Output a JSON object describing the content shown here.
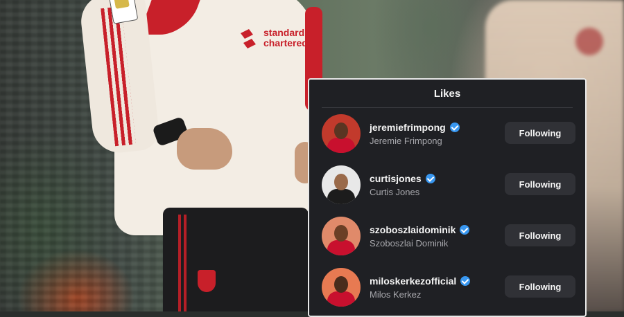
{
  "background": {
    "sponsor_text": "standard chartered"
  },
  "likes_panel": {
    "title": "Likes",
    "items": [
      {
        "username": "jeremiefrimpong",
        "full_name": "Jeremie Frimpong",
        "button_label": "Following",
        "verified": true,
        "avatar_bg": "#c23a2c",
        "avatar_shirt": "#c8102e"
      },
      {
        "username": "curtisjones",
        "full_name": "Curtis Jones",
        "button_label": "Following",
        "verified": true,
        "avatar_bg": "#e8e8e8",
        "avatar_shirt": "#1c1c1c"
      },
      {
        "username": "szoboszlaidominik",
        "full_name": "Szoboszlai Dominik",
        "button_label": "Following",
        "verified": true,
        "avatar_bg": "#e08a6a",
        "avatar_shirt": "#c8102e"
      },
      {
        "username": "miloskerkezofficial",
        "full_name": "Milos Kerkez",
        "button_label": "Following",
        "verified": true,
        "avatar_bg": "#e77a52",
        "avatar_shirt": "#c8102e"
      }
    ]
  },
  "colors": {
    "panel_bg": "#1f2024",
    "button_bg": "#303136",
    "verified_blue": "#3897f0"
  }
}
